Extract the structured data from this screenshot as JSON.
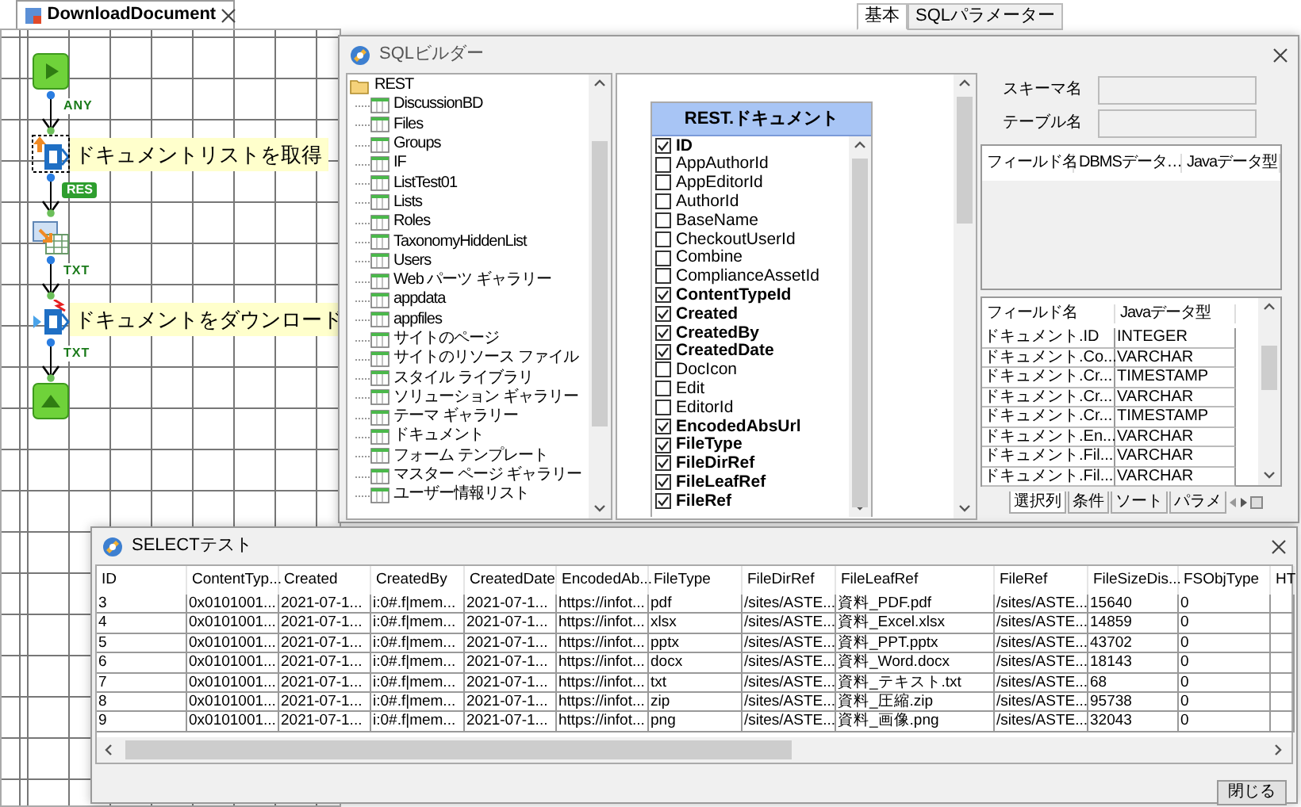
{
  "editor_tab": {
    "title": "DownloadDocument"
  },
  "property_tabs": [
    {
      "label": "基本",
      "selected": true
    },
    {
      "label": "SQLパラメーター",
      "selected": false
    }
  ],
  "flow": {
    "nodes": [
      {
        "kind": "start",
        "selected": false
      },
      {
        "kind": "sharepoint_get",
        "label": "ドキュメントリストを取得",
        "selected": true
      },
      {
        "kind": "mapper",
        "selected": false
      },
      {
        "kind": "sharepoint_download",
        "label": "ドキュメントをダウンロード",
        "selected": false
      },
      {
        "kind": "end",
        "selected": false
      }
    ],
    "links": [
      {
        "kind": "plain",
        "label": "ANY"
      },
      {
        "kind": "tag",
        "label": "RES"
      },
      {
        "kind": "plain",
        "label": "TXT"
      },
      {
        "kind": "plain",
        "label": "TXT"
      }
    ]
  },
  "sql_builder": {
    "title": "SQLビルダー",
    "tree": {
      "label": "REST",
      "children": [
        {
          "label": "DiscussionBD"
        },
        {
          "label": "Files"
        },
        {
          "label": "Groups"
        },
        {
          "label": "IF"
        },
        {
          "label": "ListTest01"
        },
        {
          "label": "Lists"
        },
        {
          "label": "Roles"
        },
        {
          "label": "TaxonomyHiddenList"
        },
        {
          "label": "Users"
        },
        {
          "label": "Web パーツ ギャラリー"
        },
        {
          "label": "appdata"
        },
        {
          "label": "appfiles"
        },
        {
          "label": "サイトのページ"
        },
        {
          "label": "サイトのリソース ファイル"
        },
        {
          "label": "スタイル ライブラリ"
        },
        {
          "label": "ソリューション ギャラリー"
        },
        {
          "label": "テーマ ギャラリー"
        },
        {
          "label": "ドキュメント"
        },
        {
          "label": "フォーム テンプレート"
        },
        {
          "label": "マスター ページ ギャラリー"
        },
        {
          "label": "ユーザー情報リスト"
        }
      ]
    },
    "table": {
      "title": "REST.ドキュメント",
      "fields": [
        {
          "name": "ID",
          "checked": true
        },
        {
          "name": "AppAuthorId",
          "checked": false
        },
        {
          "name": "AppEditorId",
          "checked": false
        },
        {
          "name": "AuthorId",
          "checked": false
        },
        {
          "name": "BaseName",
          "checked": false
        },
        {
          "name": "CheckoutUserId",
          "checked": false
        },
        {
          "name": "Combine",
          "checked": false
        },
        {
          "name": "ComplianceAssetId",
          "checked": false
        },
        {
          "name": "ContentTypeId",
          "checked": true
        },
        {
          "name": "Created",
          "checked": true
        },
        {
          "name": "CreatedBy",
          "checked": true
        },
        {
          "name": "CreatedDate",
          "checked": true
        },
        {
          "name": "DocIcon",
          "checked": false
        },
        {
          "name": "Edit",
          "checked": false
        },
        {
          "name": "EditorId",
          "checked": false
        },
        {
          "name": "EncodedAbsUrl",
          "checked": true
        },
        {
          "name": "FileType",
          "checked": true
        },
        {
          "name": "FileDirRef",
          "checked": true
        },
        {
          "name": "FileLeafRef",
          "checked": true
        },
        {
          "name": "FileRef",
          "checked": true
        }
      ]
    },
    "schema_label": "スキーマ名",
    "table_label": "テーブル名",
    "field_grid": {
      "columns": [
        "フィールド名",
        "DBMSデータ…",
        "Javaデータ型"
      ]
    },
    "selected_grid": {
      "columns": [
        "フィールド名",
        "Javaデータ型"
      ],
      "rows": [
        [
          "ドキュメント.ID",
          "INTEGER"
        ],
        [
          "ドキュメント.Co...",
          "VARCHAR"
        ],
        [
          "ドキュメント.Cr...",
          "TIMESTAMP"
        ],
        [
          "ドキュメント.Cr...",
          "VARCHAR"
        ],
        [
          "ドキュメント.Cr...",
          "TIMESTAMP"
        ],
        [
          "ドキュメント.En...",
          "VARCHAR"
        ],
        [
          "ドキュメント.Fil...",
          "VARCHAR"
        ],
        [
          "ドキュメント.Fil...",
          "VARCHAR"
        ]
      ]
    },
    "tabs": [
      {
        "label": "選択列",
        "selected": true
      },
      {
        "label": "条件",
        "selected": false
      },
      {
        "label": "ソート",
        "selected": false
      },
      {
        "label": "パラメ",
        "selected": false
      }
    ]
  },
  "select_test": {
    "title": "SELECTテスト",
    "columns": [
      "ID",
      "ContentTyp...",
      "Created",
      "CreatedBy",
      "CreatedDate",
      "EncodedAb...",
      "FileType",
      "FileDirRef",
      "FileLeafRef",
      "FileRef",
      "FileSizeDis...",
      "FSObjType",
      "HT"
    ],
    "rows": [
      [
        "3",
        "0x0101001...",
        "2021-07-1...",
        "i:0#.f|mem...",
        "2021-07-1...",
        "https://infot...",
        "pdf",
        "/sites/ASTE...",
        "資料_PDF.pdf",
        "/sites/ASTE...",
        "15640",
        "0",
        ""
      ],
      [
        "4",
        "0x0101001...",
        "2021-07-1...",
        "i:0#.f|mem...",
        "2021-07-1...",
        "https://infot...",
        "xlsx",
        "/sites/ASTE...",
        "資料_Excel.xlsx",
        "/sites/ASTE...",
        "14859",
        "0",
        ""
      ],
      [
        "5",
        "0x0101001...",
        "2021-07-1...",
        "i:0#.f|mem...",
        "2021-07-1...",
        "https://infot...",
        "pptx",
        "/sites/ASTE...",
        "資料_PPT.pptx",
        "/sites/ASTE...",
        "43702",
        "0",
        ""
      ],
      [
        "6",
        "0x0101001...",
        "2021-07-1...",
        "i:0#.f|mem...",
        "2021-07-1...",
        "https://infot...",
        "docx",
        "/sites/ASTE...",
        "資料_Word.docx",
        "/sites/ASTE...",
        "18143",
        "0",
        ""
      ],
      [
        "7",
        "0x0101001...",
        "2021-07-1...",
        "i:0#.f|mem...",
        "2021-07-1...",
        "https://infot...",
        "txt",
        "/sites/ASTE...",
        "資料_テキスト.txt",
        "/sites/ASTE...",
        "68",
        "0",
        ""
      ],
      [
        "8",
        "0x0101001...",
        "2021-07-1...",
        "i:0#.f|mem...",
        "2021-07-1...",
        "https://infot...",
        "zip",
        "/sites/ASTE...",
        "資料_圧縮.zip",
        "/sites/ASTE...",
        "95738",
        "0",
        ""
      ],
      [
        "9",
        "0x0101001...",
        "2021-07-1...",
        "i:0#.f|mem...",
        "2021-07-1...",
        "https://infot...",
        "png",
        "/sites/ASTE...",
        "資料_画像.png",
        "/sites/ASTE...",
        "32043",
        "0",
        ""
      ]
    ],
    "close_button": "閉じる"
  }
}
